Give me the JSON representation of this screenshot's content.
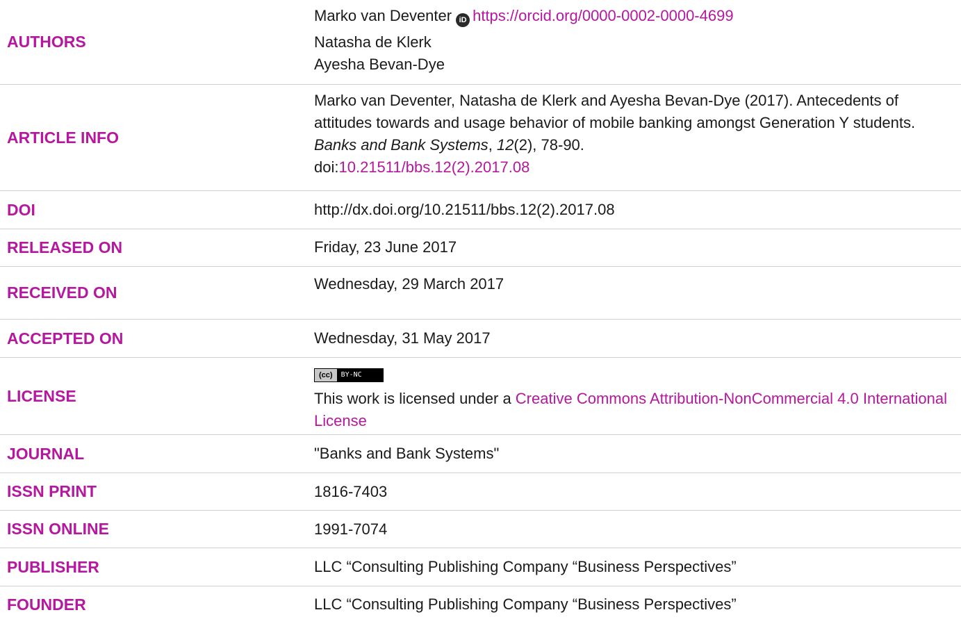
{
  "authors": {
    "label": "AUTHORS",
    "author1": "Marko van Deventer",
    "orcid_url": "https://orcid.org/0000-0002-0000-4699",
    "author2": "Natasha de Klerk",
    "author3": "Ayesha Bevan-Dye"
  },
  "article_info": {
    "label": "ARTICLE INFO",
    "citation_prefix": "Marko van Deventer, Natasha de Klerk and Ayesha Bevan-Dye (2017). Antecedents of attitudes towards and usage behavior of mobile banking amongst Generation Y students. ",
    "journal": "Banks and Bank Systems",
    "comma": ", ",
    "volume": "12",
    "issue_pages": "(2), 78-90.",
    "doi_prefix": "doi:",
    "doi_link": "10.21511/bbs.12(2).2017.08"
  },
  "doi": {
    "label": "DOI",
    "value": "http://dx.doi.org/10.21511/bbs.12(2).2017.08"
  },
  "released_on": {
    "label": "RELEASED ON",
    "value": "Friday, 23 June 2017"
  },
  "received_on": {
    "label": "RECEIVED ON",
    "value": "Wednesday, 29 March 2017"
  },
  "accepted_on": {
    "label": "ACCEPTED ON",
    "value": "Wednesday, 31 May 2017"
  },
  "license": {
    "label": "LICENSE",
    "badge_cc": "(cc)",
    "badge_terms": "BY-NC",
    "text_prefix": "This work is licensed under a ",
    "link_text": "Creative Commons Attribution-NonCommercial 4.0 International License"
  },
  "journal": {
    "label": "JOURNAL",
    "value": "\"Banks and Bank Systems\""
  },
  "issn_print": {
    "label": "ISSN PRINT",
    "value": "1816-7403"
  },
  "issn_online": {
    "label": "ISSN ONLINE",
    "value": "1991-7074"
  },
  "publisher": {
    "label": "PUBLISHER",
    "value": "LLC “Consulting Publishing Company “Business Perspectives”"
  },
  "founder": {
    "label": "FOUNDER",
    "value": "LLC “Consulting Publishing Company “Business Perspectives”"
  },
  "colors": {
    "label": "#b5179e",
    "text": "#1a1a1a",
    "divider": "#cfcfcf"
  }
}
